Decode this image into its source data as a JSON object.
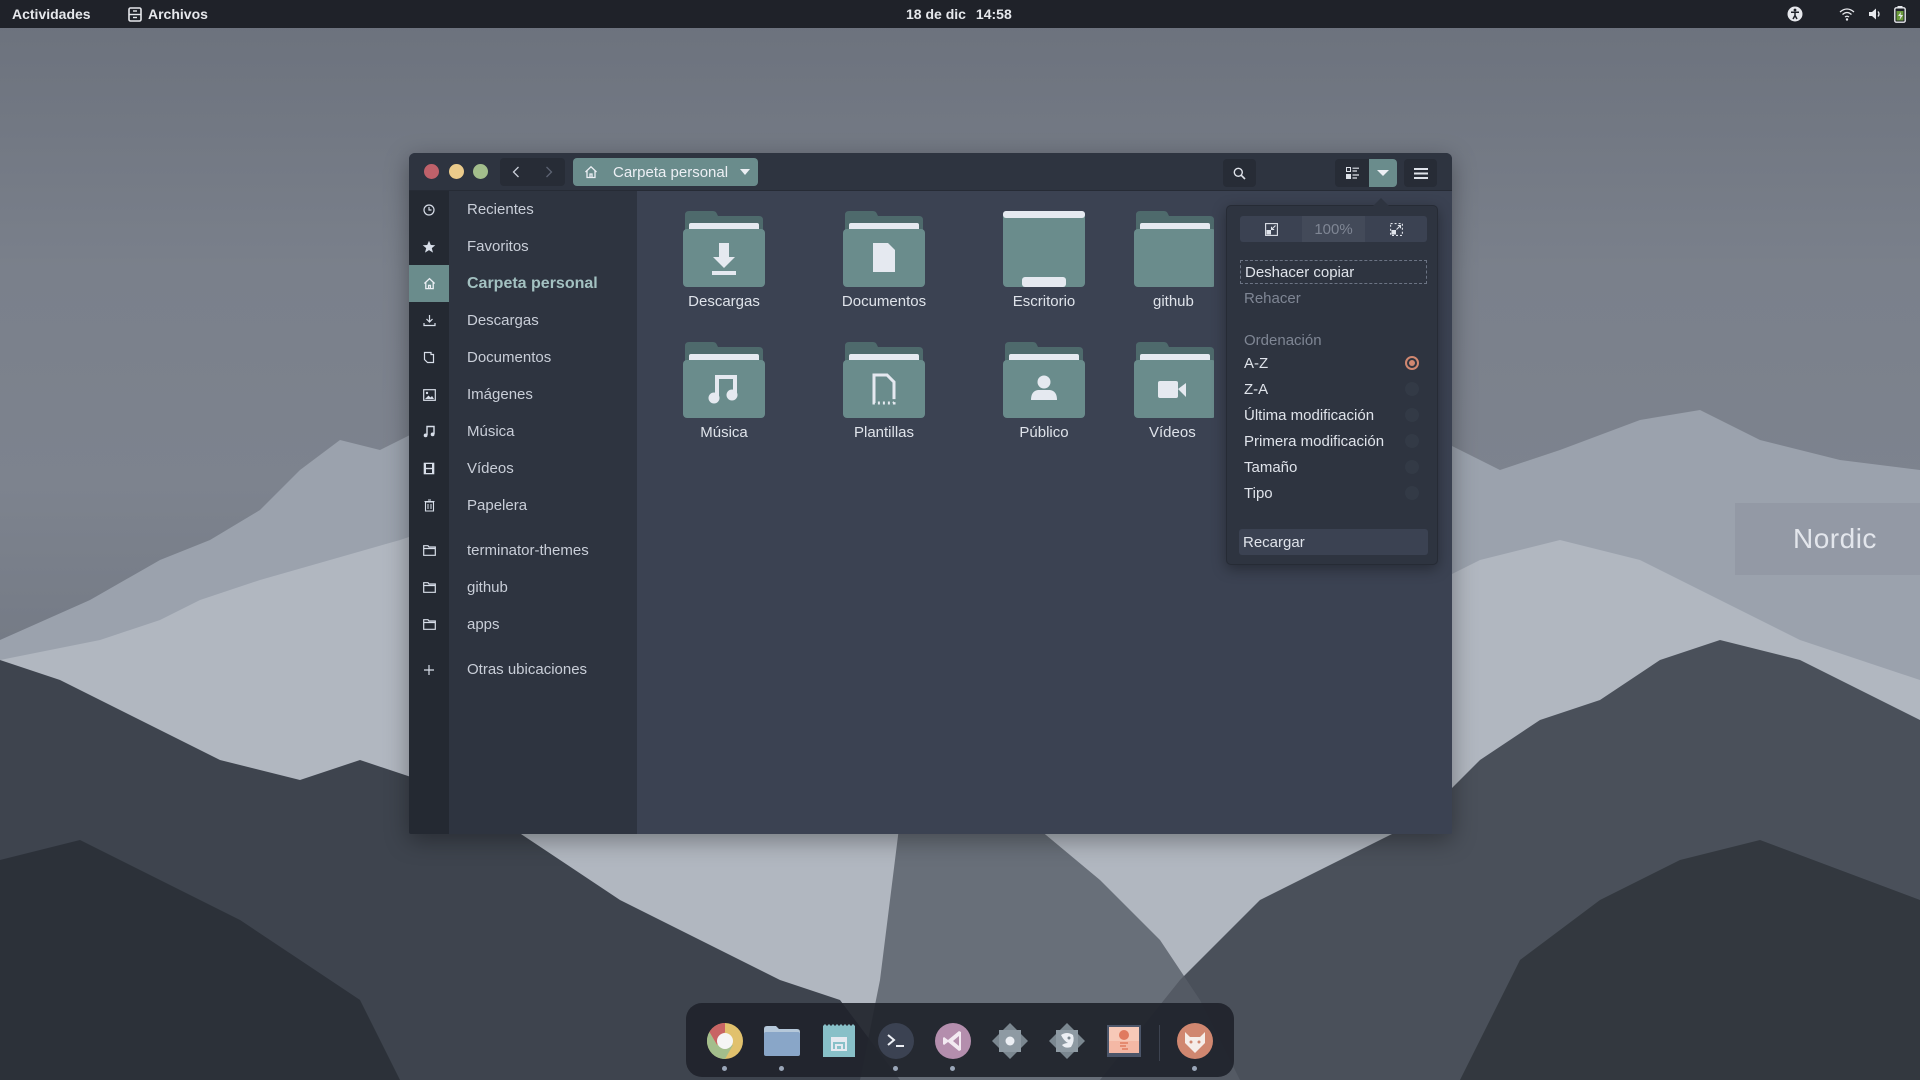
{
  "topbar": {
    "activities": "Actividades",
    "app_name": "Archivos",
    "app_icon": "file-cabinet-icon",
    "date": "18 de dic",
    "time": "14:58",
    "tray_icons": [
      "accessibility-icon",
      "wifi-icon",
      "volume-icon",
      "battery-icon"
    ]
  },
  "wallpaper": {
    "badge_text": "Nordic"
  },
  "window": {
    "nav": {
      "back_icon": "chevron-left-icon",
      "forward_icon": "chevron-right-icon"
    },
    "path": {
      "label": "Carpeta personal",
      "icon": "home-icon"
    },
    "search_icon": "search-icon",
    "view_icon": "list-view-icon",
    "menu_icon": "hamburger-icon",
    "sidebar": {
      "items": [
        {
          "label": "Recientes",
          "icon": "clock-icon"
        },
        {
          "label": "Favoritos",
          "icon": "star-icon"
        },
        {
          "label": "Carpeta personal",
          "icon": "home-icon",
          "active": true
        },
        {
          "label": "Descargas",
          "icon": "download-icon"
        },
        {
          "label": "Documentos",
          "icon": "document-icon"
        },
        {
          "label": "Imágenes",
          "icon": "image-icon"
        },
        {
          "label": "Música",
          "icon": "music-icon"
        },
        {
          "label": "Vídeos",
          "icon": "film-icon"
        },
        {
          "label": "Papelera",
          "icon": "trash-icon"
        }
      ],
      "bookmarks": [
        {
          "label": "terminator-themes",
          "icon": "folder-icon"
        },
        {
          "label": "github",
          "icon": "folder-icon"
        },
        {
          "label": "apps",
          "icon": "folder-icon"
        }
      ],
      "other": {
        "label": "Otras ubicaciones",
        "icon": "plus-icon"
      }
    },
    "folders": [
      {
        "name": "Descargas",
        "emblem": "download"
      },
      {
        "name": "Documentos",
        "emblem": "document"
      },
      {
        "name": "Escritorio",
        "emblem": "desktop"
      },
      {
        "name": "github",
        "emblem": "none"
      },
      {
        "name": "Música",
        "emblem": "music"
      },
      {
        "name": "Plantillas",
        "emblem": "template"
      },
      {
        "name": "Público",
        "emblem": "user"
      },
      {
        "name": "Vídeos",
        "emblem": "video"
      }
    ]
  },
  "popover": {
    "zoom_out_icon": "zoom-out-icon",
    "zoom_level": "100%",
    "zoom_in_icon": "zoom-in-icon",
    "undo": "Deshacer copiar",
    "redo": "Rehacer",
    "sort_heading": "Ordenación",
    "sort_options": [
      {
        "label": "A-Z",
        "checked": true
      },
      {
        "label": "Z-A",
        "checked": false
      },
      {
        "label": "Última modificación",
        "checked": false
      },
      {
        "label": "Primera modificación",
        "checked": false
      },
      {
        "label": "Tamaño",
        "checked": false
      },
      {
        "label": "Tipo",
        "checked": false
      }
    ],
    "reload": "Recargar"
  },
  "dock": {
    "items": [
      {
        "name": "chrome",
        "icon": "chrome-icon",
        "running": true
      },
      {
        "name": "files",
        "icon": "folder-icon",
        "running": true
      },
      {
        "name": "software",
        "icon": "store-icon",
        "running": false
      },
      {
        "name": "terminal",
        "icon": "terminal-icon",
        "running": true
      },
      {
        "name": "vscode",
        "icon": "vscode-icon",
        "running": true
      },
      {
        "name": "settings",
        "icon": "settings-icon",
        "running": false
      },
      {
        "name": "gimp",
        "icon": "gimp-icon",
        "running": false
      },
      {
        "name": "image-viewer",
        "icon": "image-viewer-icon",
        "running": false
      },
      {
        "name": "gitlab",
        "icon": "fox-icon",
        "running": true
      }
    ]
  },
  "colors": {
    "accent": "#6a8c8c",
    "radio_checked": "#d08770",
    "close": "#bf616a",
    "minimize": "#ebcb8b",
    "maximize": "#a3be8c"
  }
}
